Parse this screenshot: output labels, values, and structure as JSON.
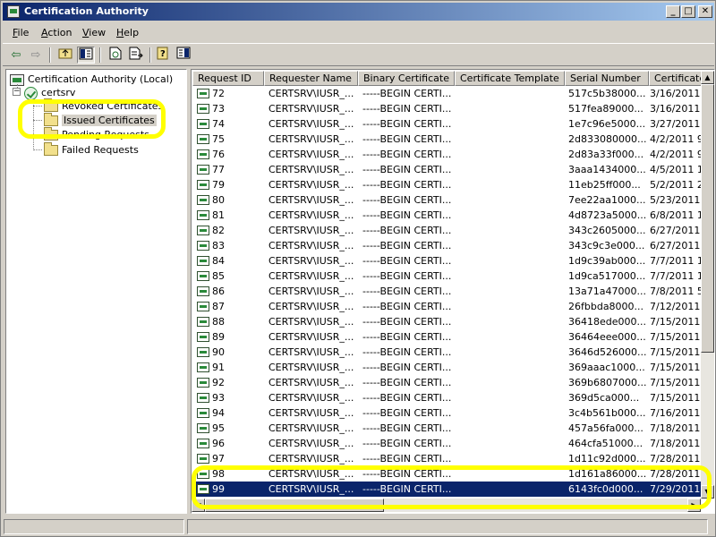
{
  "window": {
    "title": "Certification Authority"
  },
  "menu": [
    {
      "label": "File",
      "underline": "F",
      "rest": "ile"
    },
    {
      "label": "Action",
      "underline": "A",
      "rest": "ction"
    },
    {
      "label": "View",
      "underline": "V",
      "rest": "iew"
    },
    {
      "label": "Help",
      "underline": "H",
      "rest": "elp"
    }
  ],
  "tree": {
    "root": "Certification Authority (Local)",
    "server": "certsrv",
    "folders": [
      "Revoked Certificates",
      "Issued Certificates",
      "Pending Requests",
      "Failed Requests"
    ],
    "selected_folder": "Issued Certificates"
  },
  "columns": [
    "Request ID",
    "Requester Name",
    "Binary Certificate",
    "Certificate Template",
    "Serial Number",
    "Certificate"
  ],
  "rows": [
    {
      "id": "72",
      "requester": "CERTSRV\\IUSR_...",
      "binary": "-----BEGIN CERTI...",
      "template": "",
      "serial": "517c5b38000...",
      "date": "3/16/2011"
    },
    {
      "id": "73",
      "requester": "CERTSRV\\IUSR_...",
      "binary": "-----BEGIN CERTI...",
      "template": "",
      "serial": "517fea89000...",
      "date": "3/16/2011"
    },
    {
      "id": "74",
      "requester": "CERTSRV\\IUSR_...",
      "binary": "-----BEGIN CERTI...",
      "template": "",
      "serial": "1e7c96e5000...",
      "date": "3/27/2011"
    },
    {
      "id": "75",
      "requester": "CERTSRV\\IUSR_...",
      "binary": "-----BEGIN CERTI...",
      "template": "",
      "serial": "2d833080000...",
      "date": "4/2/2011 9"
    },
    {
      "id": "76",
      "requester": "CERTSRV\\IUSR_...",
      "binary": "-----BEGIN CERTI...",
      "template": "",
      "serial": "2d83a33f000...",
      "date": "4/2/2011 9"
    },
    {
      "id": "77",
      "requester": "CERTSRV\\IUSR_...",
      "binary": "-----BEGIN CERTI...",
      "template": "",
      "serial": "3aaa1434000...",
      "date": "4/5/2011 1"
    },
    {
      "id": "79",
      "requester": "CERTSRV\\IUSR_...",
      "binary": "-----BEGIN CERTI...",
      "template": "",
      "serial": "11eb25ff000...",
      "date": "5/2/2011 2"
    },
    {
      "id": "80",
      "requester": "CERTSRV\\IUSR_...",
      "binary": "-----BEGIN CERTI...",
      "template": "",
      "serial": "7ee22aa1000...",
      "date": "5/23/2011"
    },
    {
      "id": "81",
      "requester": "CERTSRV\\IUSR_...",
      "binary": "-----BEGIN CERTI...",
      "template": "",
      "serial": "4d8723a5000...",
      "date": "6/8/2011 1"
    },
    {
      "id": "82",
      "requester": "CERTSRV\\IUSR_...",
      "binary": "-----BEGIN CERTI...",
      "template": "",
      "serial": "343c2605000...",
      "date": "6/27/2011"
    },
    {
      "id": "83",
      "requester": "CERTSRV\\IUSR_...",
      "binary": "-----BEGIN CERTI...",
      "template": "",
      "serial": "343c9c3e000...",
      "date": "6/27/2011"
    },
    {
      "id": "84",
      "requester": "CERTSRV\\IUSR_...",
      "binary": "-----BEGIN CERTI...",
      "template": "",
      "serial": "1d9c39ab000...",
      "date": "7/7/2011 1"
    },
    {
      "id": "85",
      "requester": "CERTSRV\\IUSR_...",
      "binary": "-----BEGIN CERTI...",
      "template": "",
      "serial": "1d9ca517000...",
      "date": "7/7/2011 1"
    },
    {
      "id": "86",
      "requester": "CERTSRV\\IUSR_...",
      "binary": "-----BEGIN CERTI...",
      "template": "",
      "serial": "13a71a47000...",
      "date": "7/8/2011 5"
    },
    {
      "id": "87",
      "requester": "CERTSRV\\IUSR_...",
      "binary": "-----BEGIN CERTI...",
      "template": "",
      "serial": "26fbbda8000...",
      "date": "7/12/2011"
    },
    {
      "id": "88",
      "requester": "CERTSRV\\IUSR_...",
      "binary": "-----BEGIN CERTI...",
      "template": "",
      "serial": "36418ede000...",
      "date": "7/15/2011"
    },
    {
      "id": "89",
      "requester": "CERTSRV\\IUSR_...",
      "binary": "-----BEGIN CERTI...",
      "template": "",
      "serial": "36464eee000...",
      "date": "7/15/2011"
    },
    {
      "id": "90",
      "requester": "CERTSRV\\IUSR_...",
      "binary": "-----BEGIN CERTI...",
      "template": "",
      "serial": "3646d526000...",
      "date": "7/15/2011"
    },
    {
      "id": "91",
      "requester": "CERTSRV\\IUSR_...",
      "binary": "-----BEGIN CERTI...",
      "template": "",
      "serial": "369aaac1000...",
      "date": "7/15/2011"
    },
    {
      "id": "92",
      "requester": "CERTSRV\\IUSR_...",
      "binary": "-----BEGIN CERTI...",
      "template": "",
      "serial": "369b6807000...",
      "date": "7/15/2011"
    },
    {
      "id": "93",
      "requester": "CERTSRV\\IUSR_...",
      "binary": "-----BEGIN CERTI...",
      "template": "",
      "serial": "369d5ca000...",
      "date": "7/15/2011"
    },
    {
      "id": "94",
      "requester": "CERTSRV\\IUSR_...",
      "binary": "-----BEGIN CERTI...",
      "template": "",
      "serial": "3c4b561b000...",
      "date": "7/16/2011"
    },
    {
      "id": "95",
      "requester": "CERTSRV\\IUSR_...",
      "binary": "-----BEGIN CERTI...",
      "template": "",
      "serial": "457a56fa000...",
      "date": "7/18/2011"
    },
    {
      "id": "96",
      "requester": "CERTSRV\\IUSR_...",
      "binary": "-----BEGIN CERTI...",
      "template": "",
      "serial": "464cfa51000...",
      "date": "7/18/2011"
    },
    {
      "id": "97",
      "requester": "CERTSRV\\IUSR_...",
      "binary": "-----BEGIN CERTI...",
      "template": "",
      "serial": "1d11c92d000...",
      "date": "7/28/2011"
    },
    {
      "id": "98",
      "requester": "CERTSRV\\IUSR_...",
      "binary": "-----BEGIN CERTI...",
      "template": "",
      "serial": "1d161a86000...",
      "date": "7/28/2011"
    },
    {
      "id": "99",
      "requester": "CERTSRV\\IUSR_...",
      "binary": "-----BEGIN CERTI...",
      "template": "",
      "serial": "6143fc0d000...",
      "date": "7/29/2011"
    }
  ],
  "selected_row": "99",
  "colors": {
    "titlebar_start": "#0a246a",
    "titlebar_end": "#a6caf0",
    "selection": "#0a246a",
    "annotation": "#ffff00"
  }
}
